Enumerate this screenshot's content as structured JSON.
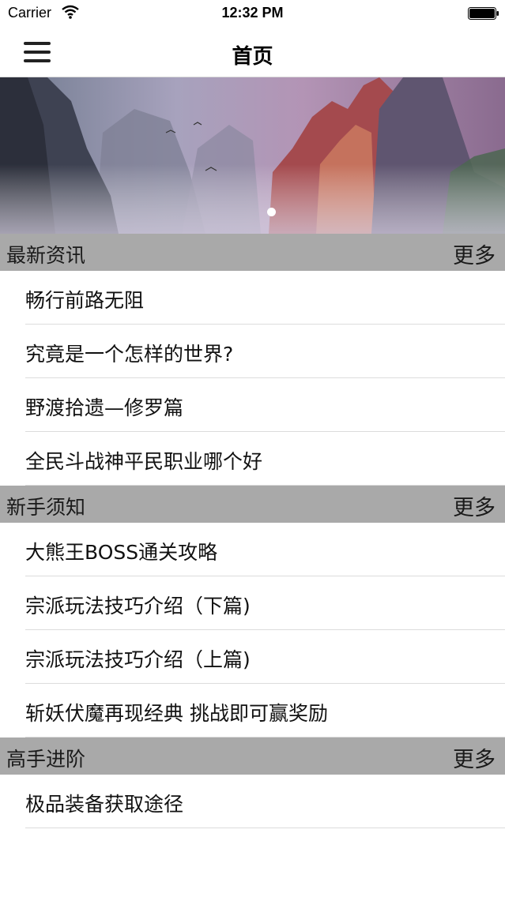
{
  "status_bar": {
    "carrier": "Carrier",
    "time": "12:32 PM"
  },
  "nav": {
    "title": "首页",
    "menu_icon": "hamburger-menu-icon"
  },
  "banner": {
    "page_count": 1,
    "current_page": 1
  },
  "sections": [
    {
      "title": "最新资讯",
      "more": "更多",
      "items": [
        "畅行前路无阻",
        "究竟是一个怎样的世界?",
        "野渡拾遗—修罗篇",
        "全民斗战神平民职业哪个好"
      ]
    },
    {
      "title": "新手须知",
      "more": "更多",
      "items": [
        "大熊王BOSS通关攻略",
        "宗派玩法技巧介绍（下篇)",
        "宗派玩法技巧介绍（上篇)",
        "斩妖伏魔再现经典 挑战即可赢奖励"
      ]
    },
    {
      "title": "高手进阶",
      "more": "更多",
      "items": [
        "极品装备获取途径"
      ]
    }
  ],
  "colors": {
    "section_header_bg": "#a9a9a9",
    "separator": "#dcdcdc"
  }
}
